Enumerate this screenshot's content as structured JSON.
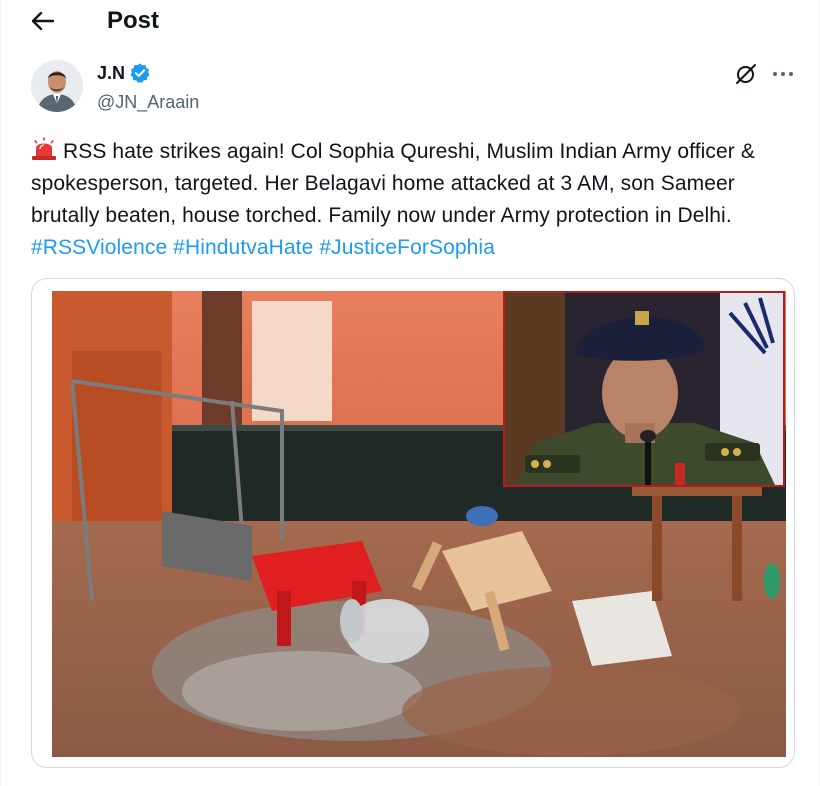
{
  "header": {
    "title": "Post",
    "back_icon": "arrow-left-icon"
  },
  "author": {
    "name": "J.N",
    "handle": "@JN_Araain",
    "verified": true,
    "verified_color": "#1d9bf0"
  },
  "actions": {
    "grok_icon": "grok-icon",
    "more_icon": "more-horizontal-icon"
  },
  "tweet": {
    "emoji": "siren-icon",
    "text": "RSS hate strikes again! Col Sophia Qureshi, Muslim Indian Army officer & spokesperson, targeted. Her Belagavi home attacked at 3 AM, son Sameer brutally beaten, house torched. Family now under Army protection in Delhi. ",
    "hashtags": [
      "#RSSViolence",
      "#HindutvaHate",
      "#JusticeForSophia"
    ],
    "hashtag_color": "#1d9bf0"
  },
  "colors": {
    "text": "#0f1419",
    "secondary": "#536471",
    "border": "#cfd9de",
    "inset_border": "#b71c1c"
  }
}
